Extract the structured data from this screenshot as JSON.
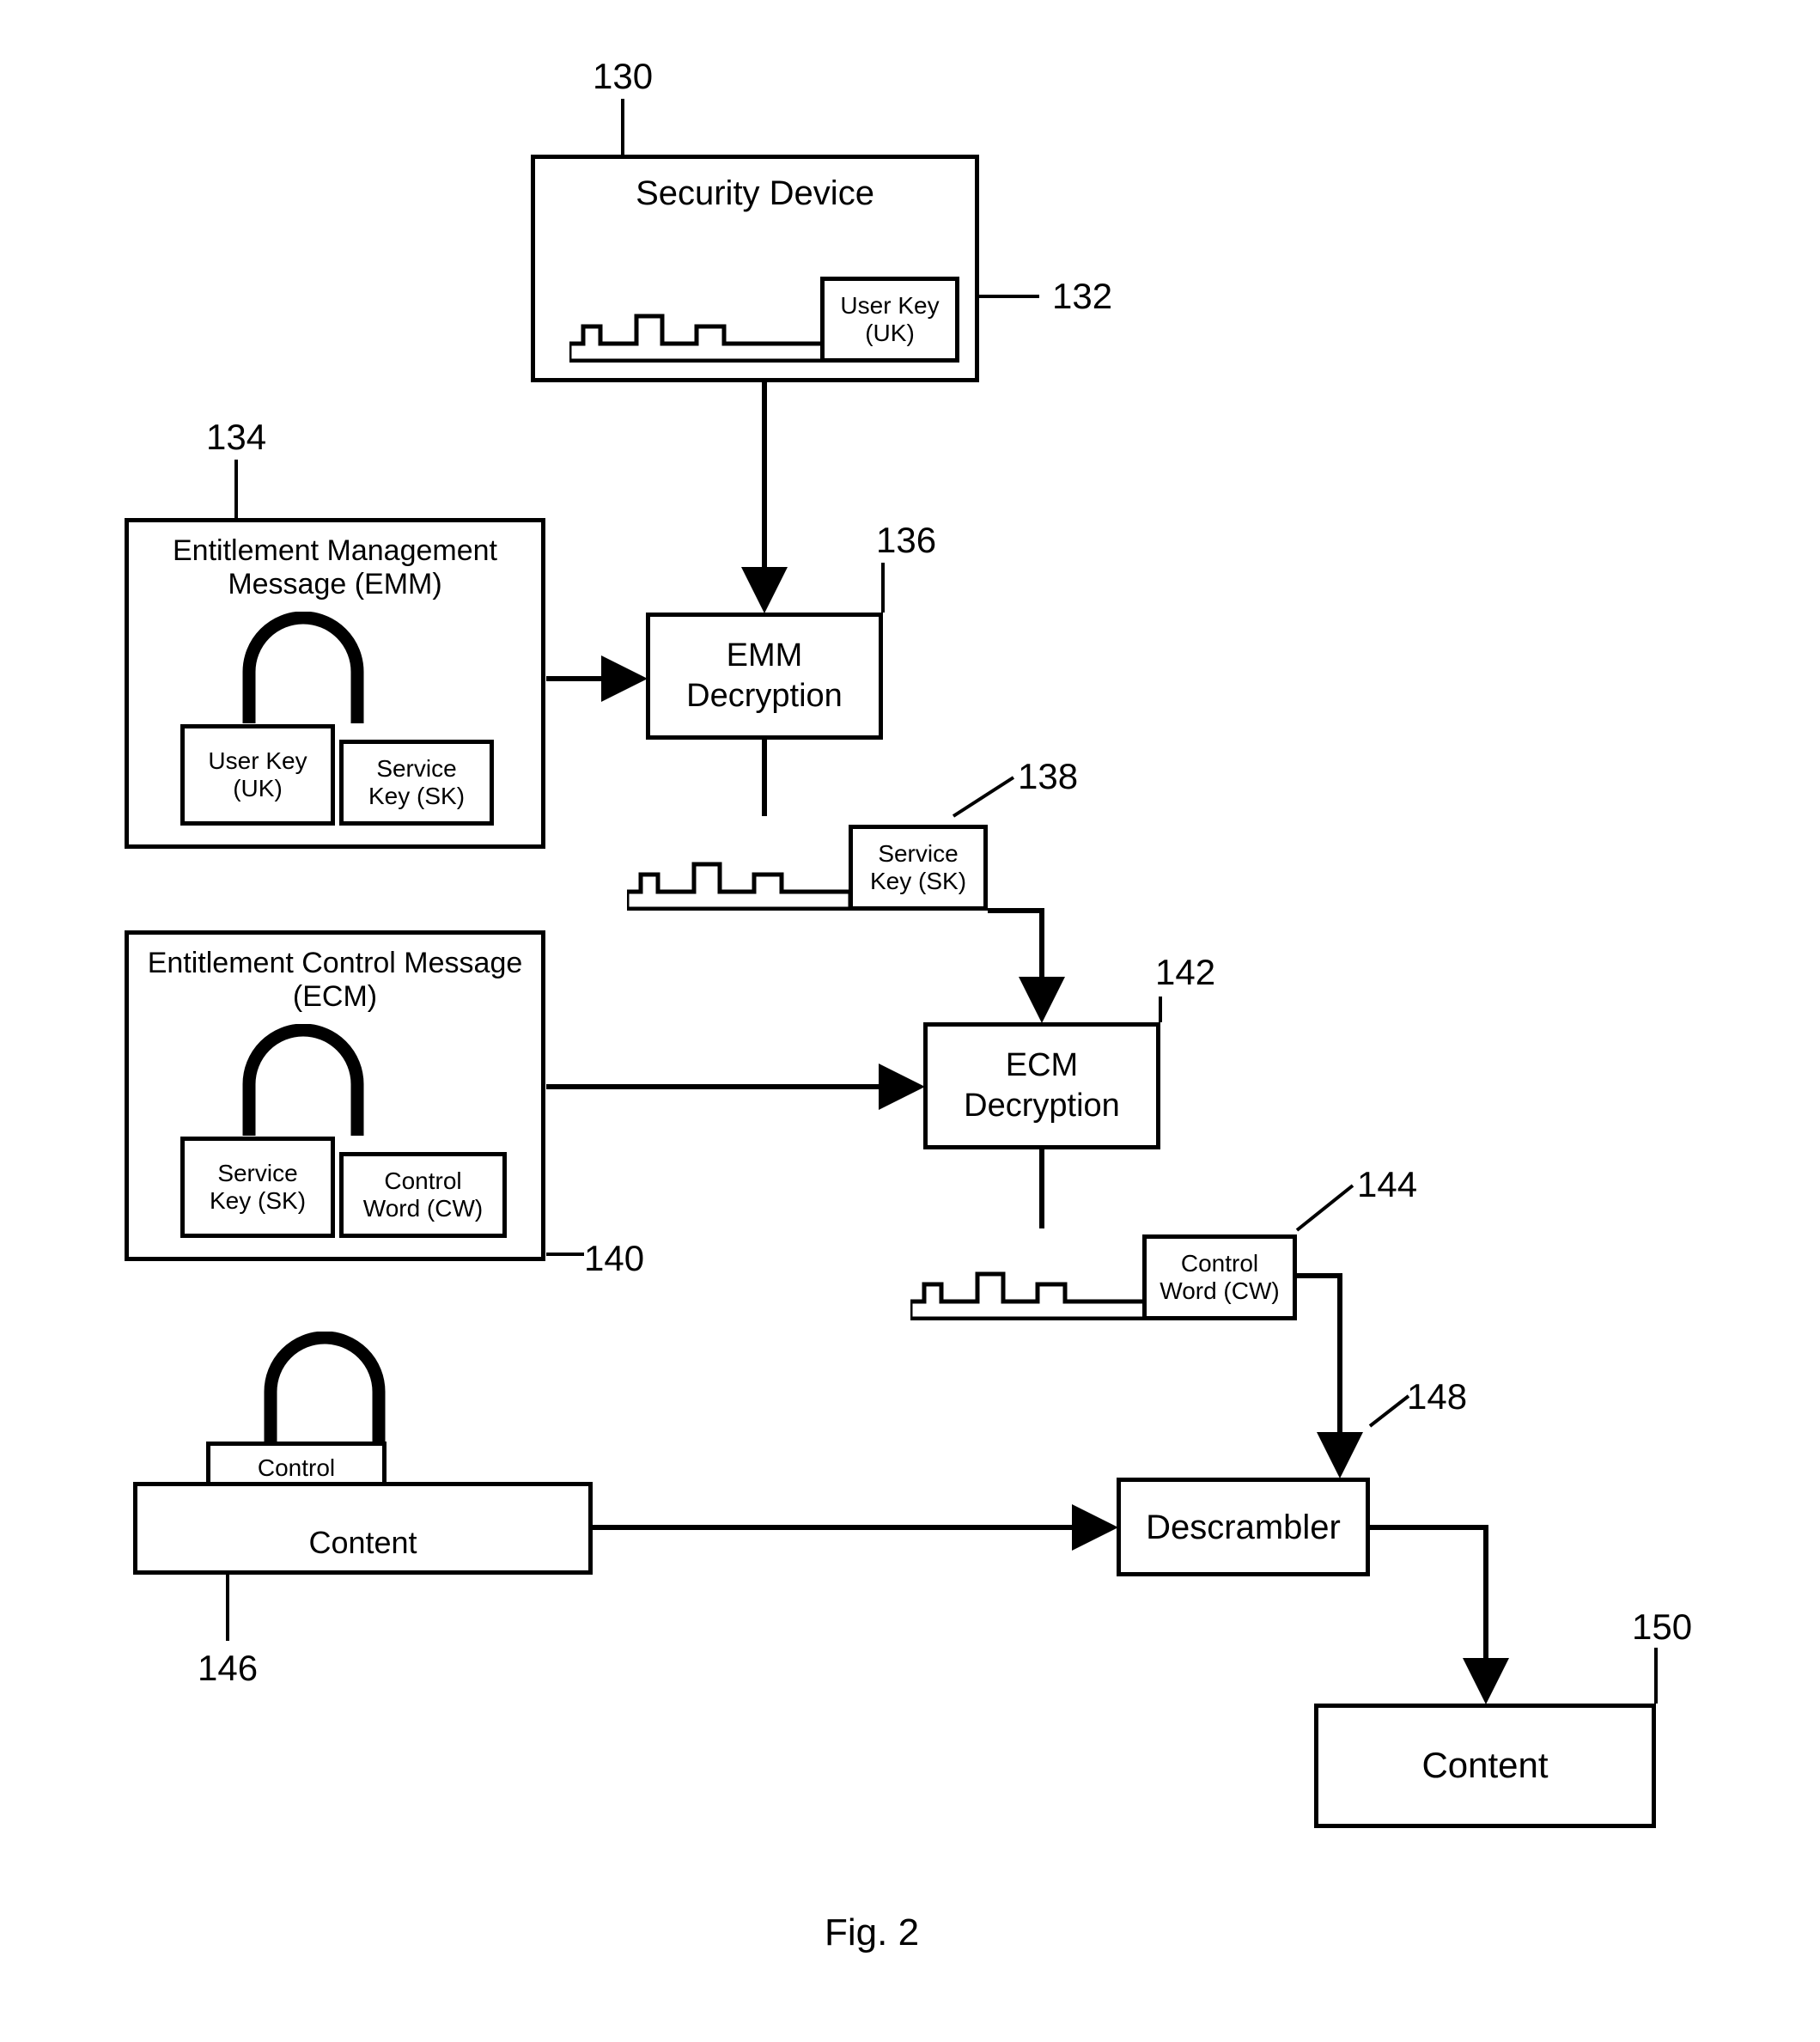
{
  "figure_label": "Fig. 2",
  "nodes": {
    "security_device": {
      "ref": "130",
      "label": "Security Device"
    },
    "user_key": {
      "ref": "132",
      "label": "User Key\n(UK)"
    },
    "emm": {
      "ref": "134",
      "title": "Entitlement Management\nMessage (EMM)",
      "lock_label": "User Key\n(UK)",
      "payload": "Service\nKey (SK)"
    },
    "emm_decryption": {
      "ref": "136",
      "label": "EMM\nDecryption"
    },
    "service_key": {
      "ref": "138",
      "label": "Service\nKey (SK)"
    },
    "ecm": {
      "ref": "140",
      "title": "Entitlement Control\nMessage (ECM)",
      "lock_label": "Service\nKey (SK)",
      "payload": "Control\nWord (CW)"
    },
    "ecm_decryption": {
      "ref": "142",
      "label": "ECM\nDecryption"
    },
    "control_word": {
      "ref": "144",
      "label": "Control\nWord (CW)"
    },
    "content_in": {
      "ref": "146",
      "lock_label": "Control\nWord (CW)",
      "label": "Content"
    },
    "descrambler": {
      "ref": "148",
      "label": "Descrambler"
    },
    "content_out": {
      "ref": "150",
      "label": "Content"
    }
  }
}
